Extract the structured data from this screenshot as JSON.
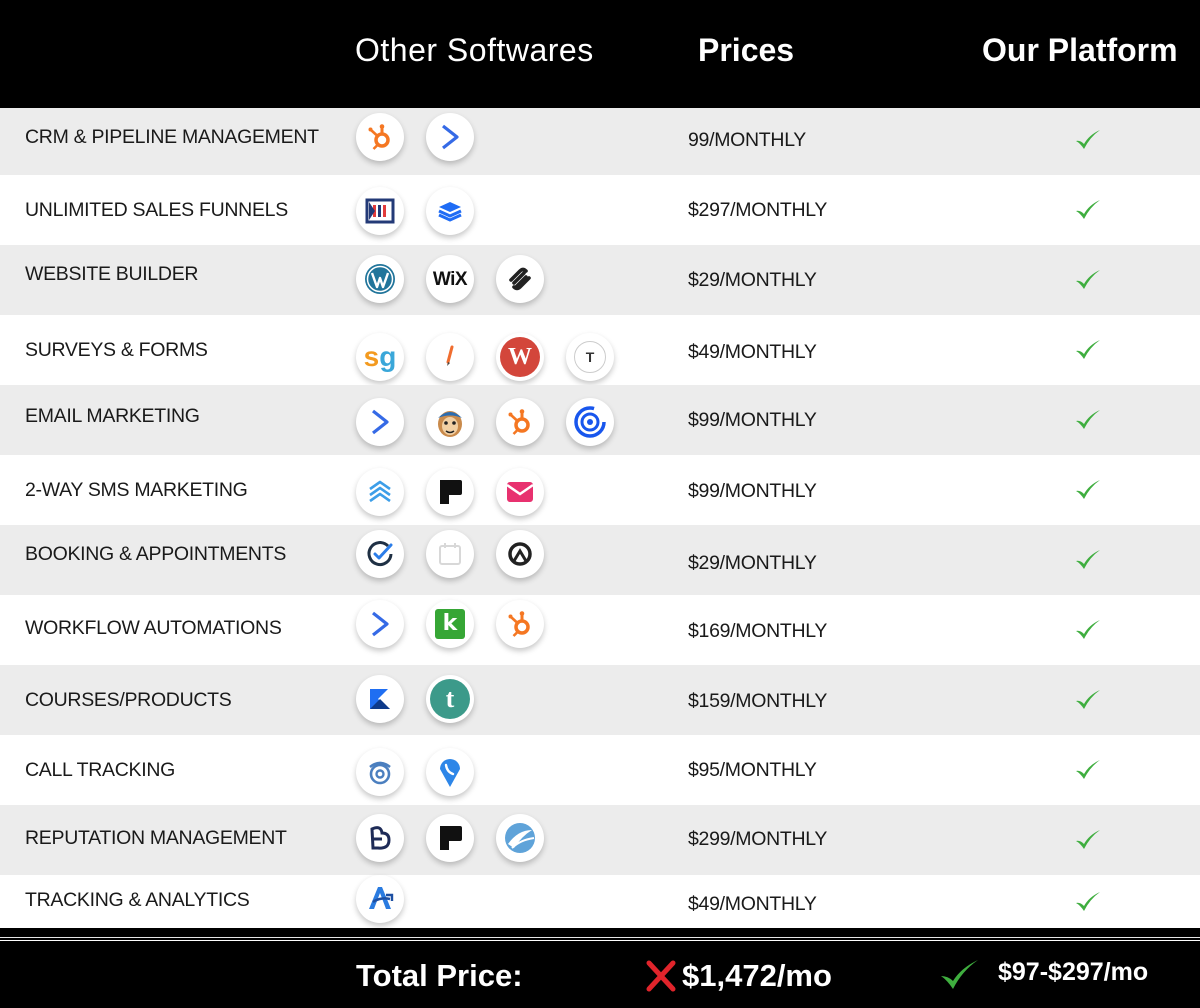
{
  "header": {
    "other_softwares": "Other Softwares",
    "prices": "Prices",
    "our_platform": "Our Platform"
  },
  "rows": [
    {
      "feature": "CRM & PIPELINE MANAGEMENT",
      "price": "99/MONTHLY",
      "logos": [
        "hubspot-icon",
        "activecampaign-icon"
      ]
    },
    {
      "feature": "UNLIMITED SALES FUNNELS",
      "price": "$297/MONTHLY",
      "logos": [
        "clickfunnels-icon",
        "leadpages-icon"
      ]
    },
    {
      "feature": "WEBSITE BUILDER",
      "price": "$29/MONTHLY",
      "logos": [
        "wordpress-icon",
        "wix-icon",
        "squarespace-icon"
      ]
    },
    {
      "feature": "SURVEYS & FORMS",
      "price": "$49/MONTHLY",
      "logos": [
        "surveygizmo-icon",
        "jotform-icon",
        "wufoo-icon",
        "typeform-icon"
      ]
    },
    {
      "feature": "EMAIL MARKETING",
      "price": "$99/MONTHLY",
      "logos": [
        "activecampaign-icon",
        "mailchimp-icon",
        "hubspot-icon",
        "constant-contact-icon"
      ]
    },
    {
      "feature": "2-WAY SMS MARKETING",
      "price": "$99/MONTHLY",
      "logos": [
        "textmagic-icon",
        "podium-icon",
        "simpletexting-icon"
      ]
    },
    {
      "feature": "BOOKING & APPOINTMENTS",
      "price": "$29/MONTHLY",
      "logos": [
        "calendly-icon",
        "calendar-icon",
        "acuity-icon"
      ]
    },
    {
      "feature": "WORKFLOW AUTOMATIONS",
      "price": "$169/MONTHLY",
      "logos": [
        "activecampaign-icon",
        "keap-icon",
        "hubspot-icon"
      ]
    },
    {
      "feature": "COURSES/PRODUCTS",
      "price": "$159/MONTHLY",
      "logos": [
        "kajabi-icon",
        "teachable-icon"
      ]
    },
    {
      "feature": "CALL TRACKING",
      "price": "$95/MONTHLY",
      "logos": [
        "callrail-icon",
        "calltrackingmetrics-icon"
      ]
    },
    {
      "feature": "REPUTATION MANAGEMENT",
      "price": "$299/MONTHLY",
      "logos": [
        "birdeye-icon",
        "podium-icon",
        "reputation-icon"
      ]
    },
    {
      "feature": "TRACKING & ANALYTICS",
      "price": "$49/MONTHLY",
      "logos": [
        "analytics-icon"
      ]
    }
  ],
  "logo_text": {
    "wix": "WiX",
    "surveygizmo": "sg",
    "wufoo": "W",
    "typeform": "T",
    "keap": "k",
    "teachable": "t"
  },
  "footer": {
    "label": "Total Price:",
    "total": "$1,472/mo",
    "ours": "$97-$297/mo"
  },
  "colors": {
    "check_green": "#3fae3f",
    "cross_red": "#e0242b",
    "header_bg": "#000000",
    "row_shade": "#ececec"
  }
}
